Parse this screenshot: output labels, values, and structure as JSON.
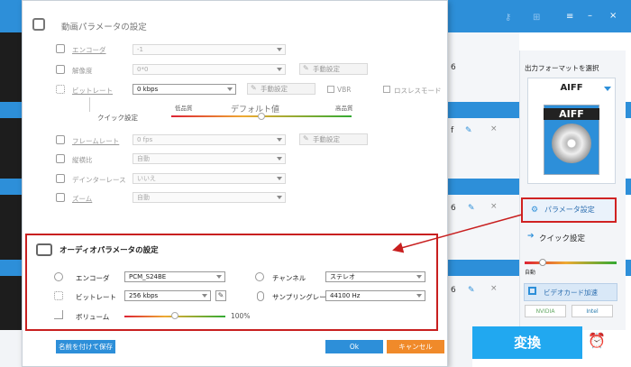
{
  "background": {
    "list_numbers": [
      "6",
      "6",
      "6"
    ],
    "list_f": "f"
  },
  "right_panel": {
    "output_title": "出力フォーマットを選択",
    "format_name": "AIFF",
    "format_icon_label": "AIFF",
    "param_button": "パラメータ設定",
    "quick_setting": "クイック設定",
    "auto_label": "自動",
    "gpu_button": "ビデオカード加速",
    "nvidia": "NVIDIA",
    "intel": "Intel",
    "convert_button": "変換"
  },
  "video": {
    "title": "動画パラメータの設定",
    "encoder_label": "エンコーダ",
    "encoder_value": "-1",
    "resolution_label": "解像度",
    "resolution_value": "0*0",
    "manual_label": "手動設定",
    "bitrate_label": "ビットレート",
    "bitrate_value": "0 kbps",
    "vbr_label": "VBR",
    "lossless_label": "ロスレスモード",
    "quick_label": "クイック設定",
    "low_label": "低品質",
    "default_label": "デフォルト値",
    "high_label": "高品質",
    "quality_level": 0.5,
    "framerate_label": "フレームレート",
    "framerate_value": "0 fps",
    "aspect_label": "縦横比",
    "aspect_value": "自動",
    "deinterlace_label": "デインターレース",
    "deinterlace_value": "いいえ",
    "zoom_label": "ズーム",
    "zoom_value": "自動"
  },
  "audio": {
    "title": "オーディオパラメータの設定",
    "encoder_label": "エンコーダ",
    "encoder_value": "PCM_S24BE",
    "channel_label": "チャンネル",
    "channel_value": "ステレオ",
    "bitrate_label": "ビットレート",
    "bitrate_value": "256 kbps",
    "samplerate_label": "サンプリングレート",
    "samplerate_value": "44100 Hz",
    "volume_label": "ボリューム",
    "volume_value": "100%",
    "volume_level": 0.5
  },
  "footer": {
    "save_as": "名前を付けて保存",
    "ok": "Ok",
    "cancel": "キャンセル"
  },
  "colors": {
    "accent": "#2d8fd9",
    "highlight": "#c81f1f",
    "cancel": "#f08a2a"
  }
}
